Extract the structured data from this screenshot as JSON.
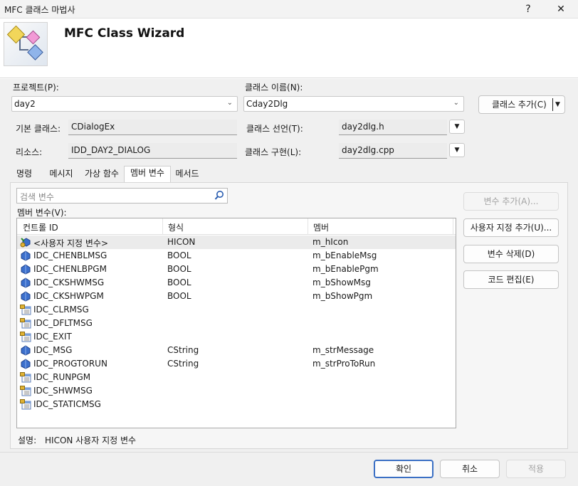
{
  "window": {
    "title": "MFC 클래스 마법사",
    "help": "?",
    "close": "✕"
  },
  "header": {
    "title": "MFC Class Wizard"
  },
  "form": {
    "project_label": "프로젝트(P):",
    "project_value": "day2",
    "class_name_label": "클래스 이름(N):",
    "class_name_value": "Cday2Dlg",
    "add_class_label": "클래스 추가(C)",
    "base_class_label": "기본 클래스:",
    "base_class_value": "CDialogEx",
    "class_decl_label": "클래스 선언(T):",
    "class_decl_value": "day2dlg.h",
    "resource_label": "리소스:",
    "resource_value": "IDD_DAY2_DIALOG",
    "class_impl_label": "클래스 구현(L):",
    "class_impl_value": "day2dlg.cpp"
  },
  "tabs": [
    "명령",
    "메시지",
    "가상 함수",
    "멤버 변수",
    "메서드"
  ],
  "active_tab": "멤버 변수",
  "panel": {
    "search_placeholder": "검색 변수",
    "list_label": "멤버 변수(V):",
    "columns": [
      "컨트롤 ID",
      "형식",
      "멤버"
    ],
    "rows": [
      {
        "id": "<사용자 지정 변수>",
        "type": "HICON",
        "member": "m_hIcon",
        "icon": "custom-variable-icon",
        "selected": true
      },
      {
        "id": "IDC_CHENBLMSG",
        "type": "BOOL",
        "member": "m_bEnableMsg",
        "icon": "variable-icon"
      },
      {
        "id": "IDC_CHENLBPGM",
        "type": "BOOL",
        "member": "m_bEnablePgm",
        "icon": "variable-icon"
      },
      {
        "id": "IDC_CKSHWMSG",
        "type": "BOOL",
        "member": "m_bShowMsg",
        "icon": "variable-icon"
      },
      {
        "id": "IDC_CKSHWPGM",
        "type": "BOOL",
        "member": "m_bShowPgm",
        "icon": "variable-icon"
      },
      {
        "id": "IDC_CLRMSG",
        "type": "",
        "member": "",
        "icon": "control-icon"
      },
      {
        "id": "IDC_DFLTMSG",
        "type": "",
        "member": "",
        "icon": "control-icon"
      },
      {
        "id": "IDC_EXIT",
        "type": "",
        "member": "",
        "icon": "control-icon"
      },
      {
        "id": "IDC_MSG",
        "type": "CString",
        "member": "m_strMessage",
        "icon": "variable-icon"
      },
      {
        "id": "IDC_PROGTORUN",
        "type": "CString",
        "member": "m_strProToRun",
        "icon": "variable-icon"
      },
      {
        "id": "IDC_RUNPGM",
        "type": "",
        "member": "",
        "icon": "control-icon"
      },
      {
        "id": "IDC_SHWMSG",
        "type": "",
        "member": "",
        "icon": "control-icon"
      },
      {
        "id": "IDC_STATICMSG",
        "type": "",
        "member": "",
        "icon": "control-icon"
      }
    ],
    "buttons": {
      "add_variable": "변수 추가(A)...",
      "add_custom": "사용자 지정 추가(U)...",
      "delete_variable": "변수 삭제(D)",
      "edit_code": "코드 편집(E)"
    },
    "description_label": "설명:",
    "description_value": "HICON 사용자 지정 변수"
  },
  "footer": {
    "ok": "확인",
    "cancel": "취소",
    "apply": "적용"
  },
  "colors": {
    "accent": "#3a6fc4",
    "icon_blue": "#3b6fcc",
    "icon_gold": "#e0b233"
  }
}
